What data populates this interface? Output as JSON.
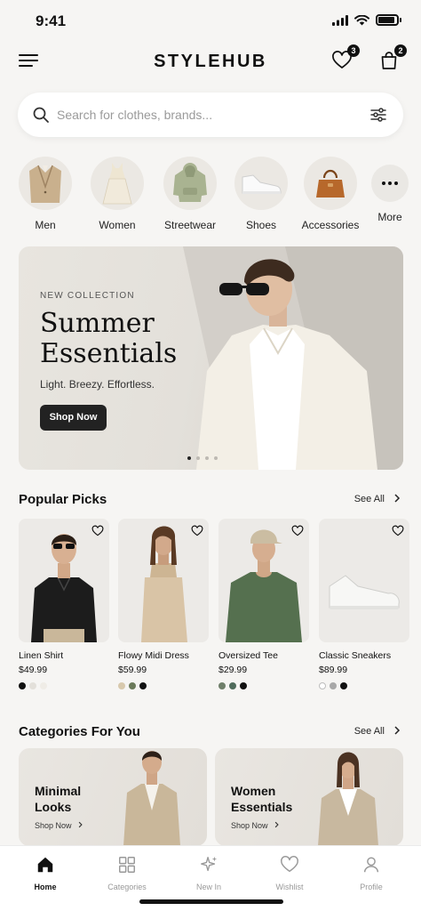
{
  "status": {
    "time": "9:41"
  },
  "header": {
    "brand": "STYLEHUB",
    "wishlist_count": "3",
    "cart_count": "2"
  },
  "search": {
    "placeholder": "Search for clothes, brands..."
  },
  "categories": [
    {
      "label": "Men",
      "icon": "blazer-icon"
    },
    {
      "label": "Women",
      "icon": "dress-icon"
    },
    {
      "label": "Streetwear",
      "icon": "hoodie-icon"
    },
    {
      "label": "Shoes",
      "icon": "sneaker-icon"
    },
    {
      "label": "Accessories",
      "icon": "handbag-icon"
    },
    {
      "label": "More",
      "icon": "more-icon"
    }
  ],
  "hero": {
    "kicker": "NEW COLLECTION",
    "title": "Summer Essentials",
    "subtitle": "Light. Breezy. Effortless.",
    "button": "Shop Now"
  },
  "popular": {
    "title": "Popular Picks",
    "see_all": "See All",
    "items": [
      {
        "name": "Linen Shirt",
        "price": "$49.99",
        "swatches": [
          "#111111",
          "#e3e0da",
          "#efece6"
        ]
      },
      {
        "name": "Flowy Midi Dress",
        "price": "$59.99",
        "swatches": [
          "#d8c9ad",
          "#6b7a5a",
          "#111111"
        ]
      },
      {
        "name": "Oversized Tee",
        "price": "$29.99",
        "swatches": [
          "#6f7f6a",
          "#4f6b5b",
          "#111111"
        ]
      },
      {
        "name": "Classic Sneakers",
        "price": "$89.99",
        "swatches": [
          "#ffffff",
          "#a8a8a8",
          "#111111"
        ]
      }
    ]
  },
  "for_you": {
    "title": "Categories For You",
    "see_all": "See All",
    "cards": [
      {
        "title": "Minimal Looks",
        "link": "Shop Now"
      },
      {
        "title": "Women Essentials",
        "link": "Shop Now"
      }
    ]
  },
  "tabs": [
    {
      "label": "Home",
      "icon": "home-icon"
    },
    {
      "label": "Categories",
      "icon": "grid-icon"
    },
    {
      "label": "New In",
      "icon": "sparkle-icon"
    },
    {
      "label": "Wishlist",
      "icon": "heart-icon"
    },
    {
      "label": "Profile",
      "icon": "user-icon"
    }
  ],
  "colors": {
    "accent": "#111111",
    "background": "#f6f5f3",
    "inactive": "#999999"
  }
}
